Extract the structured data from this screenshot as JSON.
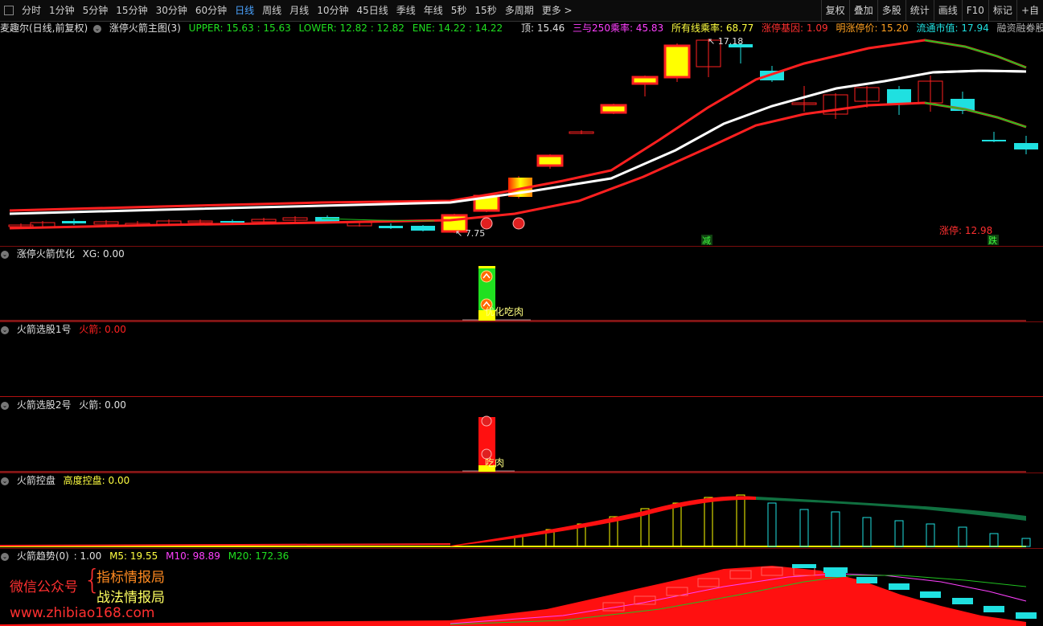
{
  "toolbar": {
    "items": [
      "分时",
      "1分钟",
      "5分钟",
      "15分钟",
      "30分钟",
      "60分钟",
      "日线",
      "周线",
      "月线",
      "10分钟",
      "45日线",
      "季线",
      "年线",
      "5秒",
      "15秒",
      "多周期",
      "更多 >"
    ],
    "active_index": 6,
    "right_items": [
      "复权",
      "叠加",
      "多股",
      "统计",
      "画线",
      "F10",
      "标记",
      "+自"
    ]
  },
  "main": {
    "stock": "麦趣尔(日线,前复权)",
    "indicator": "涨停火箭主图(3)",
    "upper": "UPPER: 15.63 : 15.63",
    "lower": "LOWER: 12.82 : 12.82",
    "ene": "ENE: 14.22 : 14.22",
    "top": "顶: 15.46",
    "ratio250": "三与250乘率: 45.83",
    "all_ratio": "所有线乘率: 68.77",
    "limit_gene": "涨停基因: 1.09",
    "next_limit": "明涨停价: 15.20",
    "float_value": "流通市值: 17.94",
    "margin": "融资融券股: -",
    "high_label": "17.18",
    "low_label": "7.75",
    "limit_label": "涨停: 12.98",
    "jian_label": "减",
    "die_label": "跌"
  },
  "p1": {
    "name": "涨停火箭优化",
    "value": "XG: 0.00",
    "label": "优化吃肉"
  },
  "p2": {
    "name": "火箭选股1号",
    "value": "火箭: 0.00"
  },
  "p3": {
    "name": "火箭选股2号",
    "value": "火箭: 0.00",
    "label": "吃肉"
  },
  "p4": {
    "name": "火箭控盘",
    "value": "高度控盘: 0.00"
  },
  "p5": {
    "name": "火箭趋势(0)",
    "v1": ": 1.00",
    "m5": "M5: 19.55",
    "m10": "M10: 98.89",
    "m20": "M20: 172.36"
  },
  "watermark": {
    "left": "微信公众号",
    "line1": "指标情报局",
    "line2": "战法情报局",
    "url": "www.zhibiao168.com"
  },
  "colors": {
    "up": "#ff2020",
    "down": "#1fe0e0",
    "yellow": "#ffff00",
    "white": "#ffffff",
    "green": "#20c020",
    "magenta": "#ff40ff"
  }
}
